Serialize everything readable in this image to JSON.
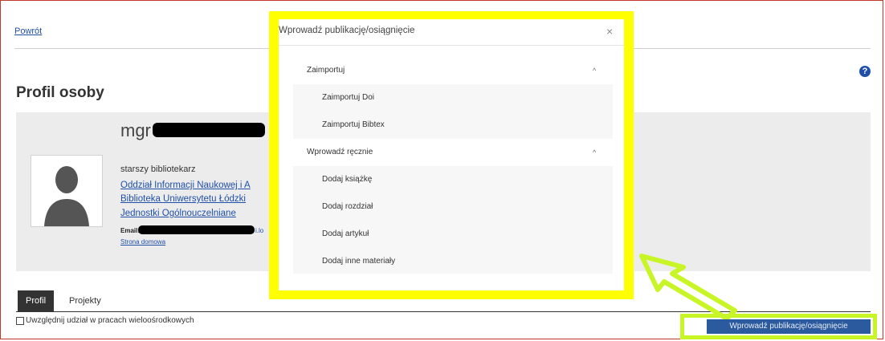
{
  "nav": {
    "back_label": "Powrót"
  },
  "page": {
    "title": "Profil osoby",
    "help_icon": "question-circle-icon"
  },
  "profile": {
    "name_prefix": "mgr",
    "role": "starszy bibliotekarz",
    "units": [
      "Oddział Informacji Naukowej i A",
      "Biblioteka Uniwersytetu Łódzki",
      "Jednostki Ogólnouczelniane"
    ],
    "email_label": "Email:",
    "email_tail": "i.lo",
    "homepage_label": "Strona domowa"
  },
  "tabs": [
    {
      "label": "Profil"
    },
    {
      "label": "Projekty"
    }
  ],
  "options": {
    "multicenter_label": "Uwzględnij udział w pracach wieloośrodkowych"
  },
  "actions": {
    "add_publication_label": "Wprowadź publikację/osiągnięcie"
  },
  "modal": {
    "title": "Wprowadź publikację/osiągnięcie",
    "close_glyph": "×",
    "sections": [
      {
        "label": "Zaimportuj",
        "chevron": "^",
        "items": [
          "Zaimportuj Doi",
          "Zaimportuj Bibtex"
        ]
      },
      {
        "label": "Wprowadź ręcznie",
        "chevron": "^",
        "items": [
          "Dodaj książkę",
          "Dodaj rozdział",
          "Dodaj artykuł",
          "Dodaj inne materiały"
        ]
      }
    ]
  },
  "colors": {
    "highlight_modal": "#ffff00",
    "highlight_button": "#c8f526",
    "link": "#1f4fa8",
    "button": "#2b5a9e"
  }
}
